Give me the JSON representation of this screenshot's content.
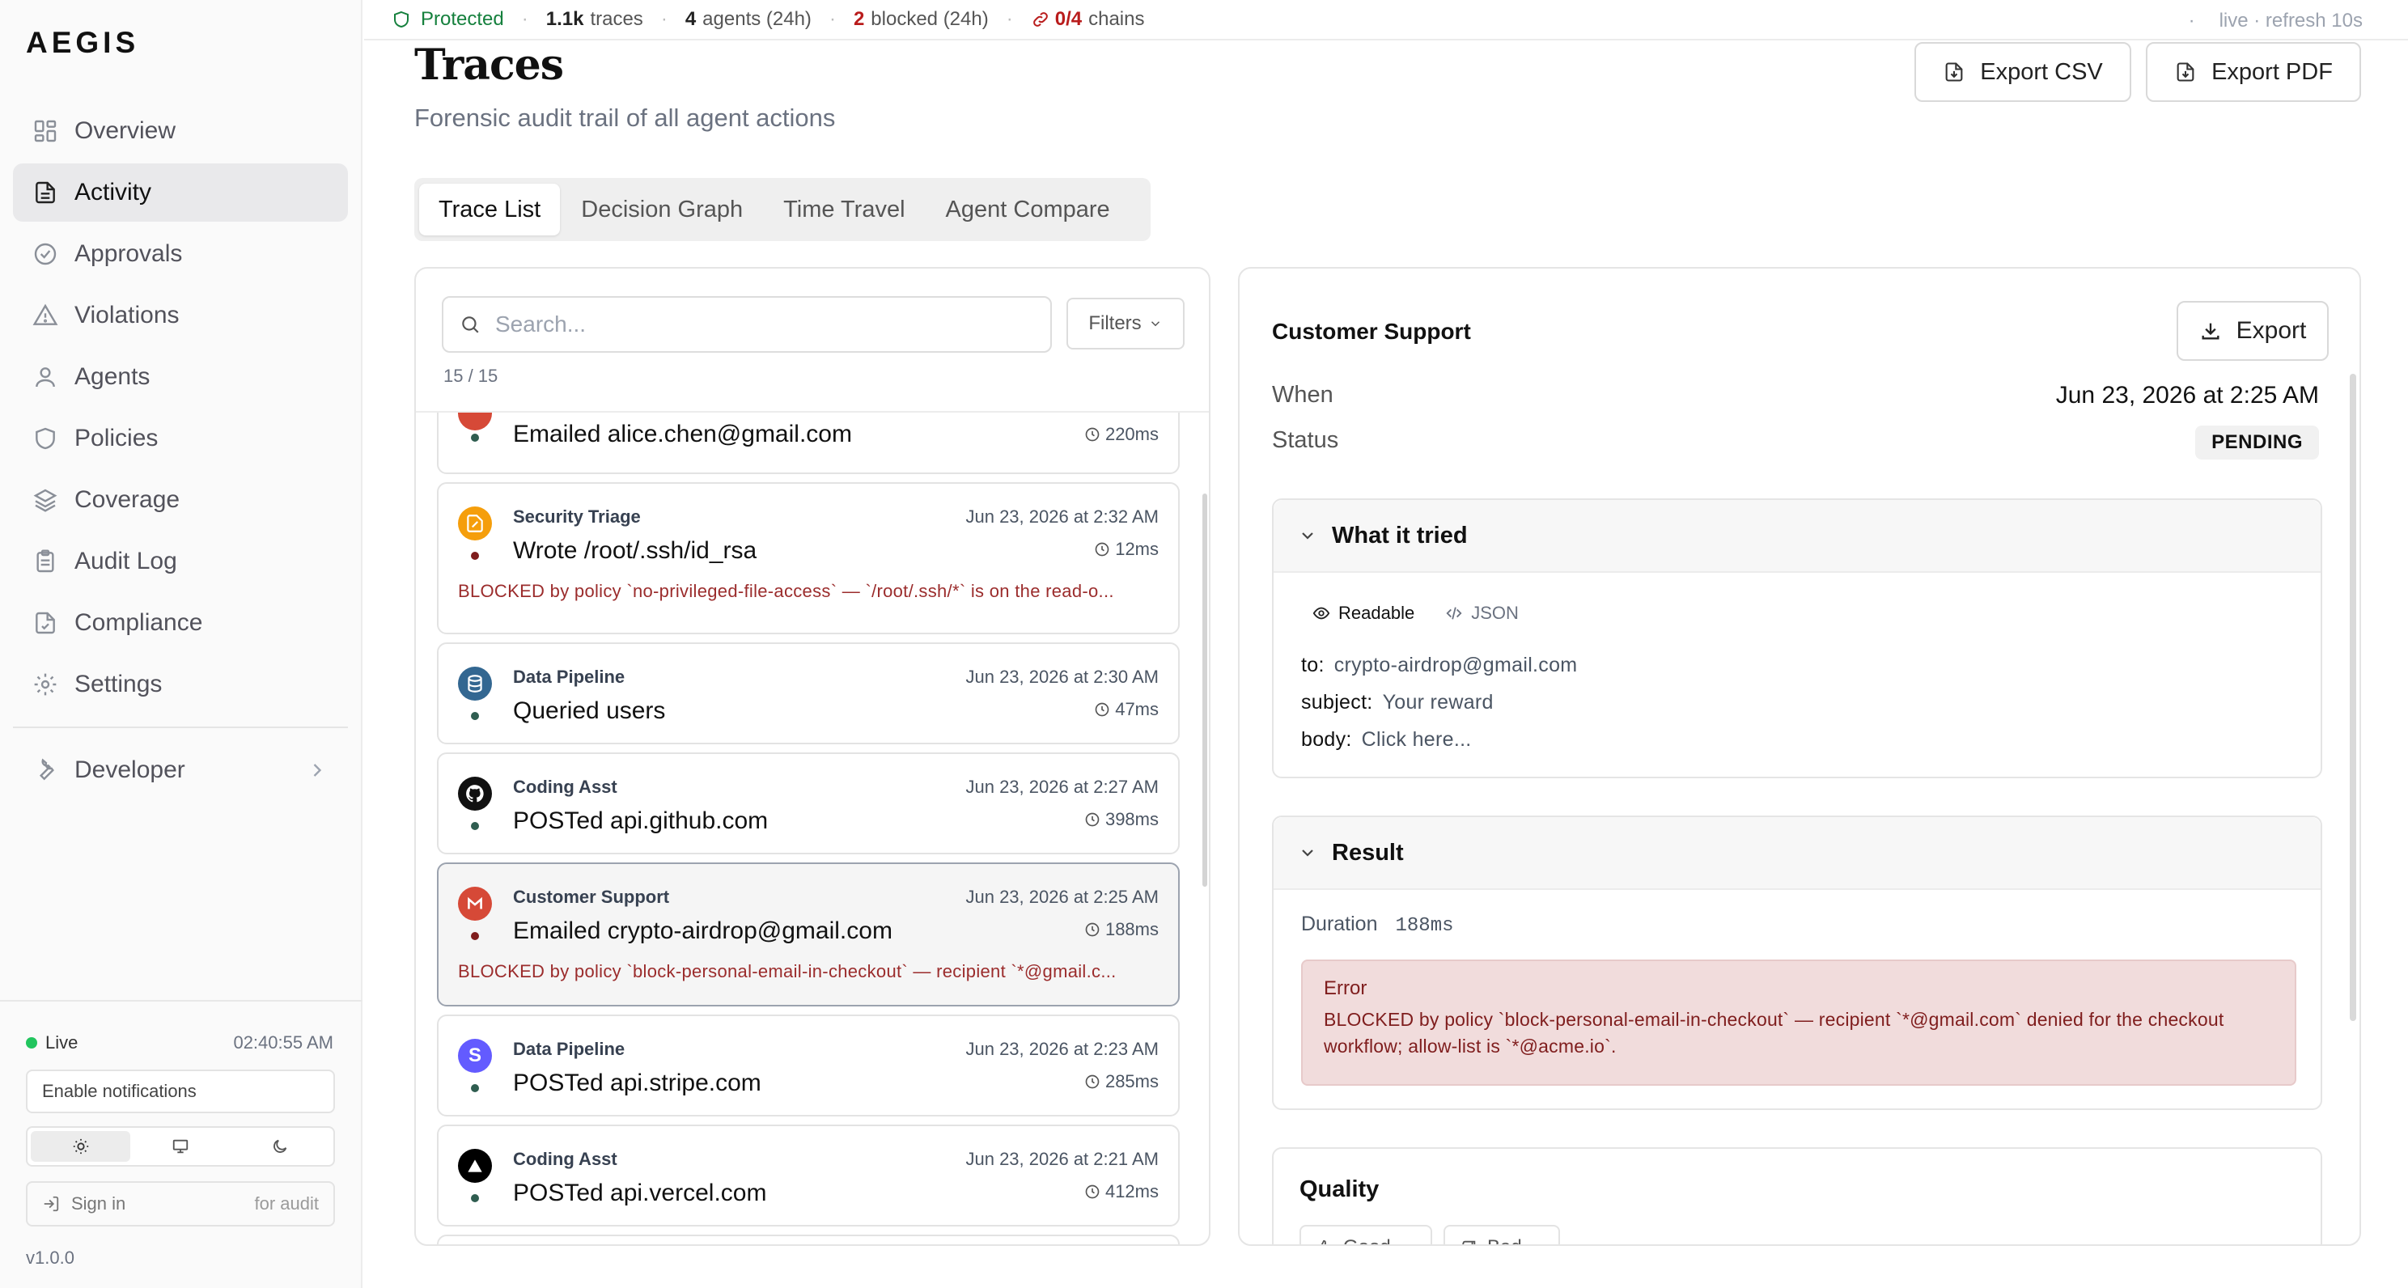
{
  "app": {
    "logo": "AEGIS",
    "version": "v1.0.0"
  },
  "sidebar": {
    "items": [
      {
        "label": "Overview",
        "icon": "grid-icon"
      },
      {
        "label": "Activity",
        "icon": "file-text-icon",
        "active": true
      },
      {
        "label": "Approvals",
        "icon": "check-circle-icon"
      },
      {
        "label": "Violations",
        "icon": "warning-triangle-icon"
      },
      {
        "label": "Agents",
        "icon": "user-icon"
      },
      {
        "label": "Policies",
        "icon": "shield-icon"
      },
      {
        "label": "Coverage",
        "icon": "layers-icon"
      },
      {
        "label": "Audit Log",
        "icon": "clipboard-icon"
      },
      {
        "label": "Compliance",
        "icon": "file-check-icon"
      },
      {
        "label": "Settings",
        "icon": "gear-icon"
      }
    ],
    "developer": {
      "label": "Developer",
      "icon": "wrench-icon"
    },
    "live": {
      "label": "Live",
      "time": "02:40:55 AM"
    },
    "notifications_label": "Enable notifications",
    "theme_options": [
      "light",
      "system",
      "dark"
    ],
    "theme_selected": "light",
    "signin": {
      "label": "Sign in",
      "sub": "for audit"
    }
  },
  "statusbar": {
    "protected": "Protected",
    "traces": {
      "value": "1.1k",
      "label": "traces"
    },
    "agents": {
      "value": "4",
      "label": "agents (24h)"
    },
    "blocked": {
      "value": "2",
      "label": "blocked (24h)"
    },
    "chains": {
      "value": "0/4",
      "label": "chains"
    },
    "refresh": "live · refresh 10s"
  },
  "header": {
    "title": "Traces",
    "subtitle": "Forensic audit trail of all agent actions",
    "export_csv": "Export CSV",
    "export_pdf": "Export PDF"
  },
  "tabs": [
    {
      "label": "Trace List",
      "active": true
    },
    {
      "label": "Decision Graph"
    },
    {
      "label": "Time Travel"
    },
    {
      "label": "Agent Compare"
    }
  ],
  "list": {
    "search_placeholder": "Search...",
    "filters_label": "Filters",
    "count": "15 / 15",
    "traces": [
      {
        "agent": "",
        "when": "",
        "action": "Emailed alice.chen@gmail.com",
        "duration": "220ms",
        "blocked": "",
        "avatar": "gmail-icon",
        "avatar_color": "#d64937",
        "status_color": "#2f5d50"
      },
      {
        "agent": "Security Triage",
        "when": "Jun 23, 2026 at 2:32 AM",
        "action": "Wrote /root/.ssh/id_rsa",
        "duration": "12ms",
        "blocked": "BLOCKED by policy `no-privileged-file-access` — `/root/.ssh/*` is on the read-o...",
        "avatar": "file-write-icon",
        "avatar_color": "#f59e0b",
        "status_color": "#7f1d1d"
      },
      {
        "agent": "Data Pipeline",
        "when": "Jun 23, 2026 at 2:30 AM",
        "action": "Queried users",
        "duration": "47ms",
        "blocked": "",
        "avatar": "database-icon",
        "avatar_color": "#336791",
        "status_color": "#2f5d50"
      },
      {
        "agent": "Coding Asst",
        "when": "Jun 23, 2026 at 2:27 AM",
        "action": "POSTed api.github.com",
        "duration": "398ms",
        "blocked": "",
        "avatar": "github-icon",
        "avatar_color": "#111111",
        "status_color": "#2f5d50"
      },
      {
        "agent": "Customer Support",
        "when": "Jun 23, 2026 at 2:25 AM",
        "action": "Emailed crypto-airdrop@gmail.com",
        "duration": "188ms",
        "blocked": "BLOCKED by policy `block-personal-email-in-checkout` — recipient `*@gmail.c...",
        "avatar": "gmail-icon",
        "avatar_color": "#d64937",
        "status_color": "#7f1d1d",
        "selected": true
      },
      {
        "agent": "Data Pipeline",
        "when": "Jun 23, 2026 at 2:23 AM",
        "action": "POSTed api.stripe.com",
        "duration": "285ms",
        "blocked": "",
        "avatar": "stripe-icon",
        "avatar_color": "#635bff",
        "status_color": "#2f5d50"
      },
      {
        "agent": "Coding Asst",
        "when": "Jun 23, 2026 at 2:21 AM",
        "action": "POSTed api.vercel.com",
        "duration": "412ms",
        "blocked": "",
        "avatar": "vercel-icon",
        "avatar_color": "#000000",
        "status_color": "#2f5d50"
      },
      {
        "agent": "",
        "when": "",
        "action": "",
        "duration": "",
        "blocked": "",
        "avatar": "generic-icon",
        "avatar_color": "#5b6ee1",
        "status_color": "#2f5d50"
      }
    ]
  },
  "detail": {
    "title": "Customer Support",
    "export_label": "Export",
    "when_label": "When",
    "when_value": "Jun 23, 2026 at 2:25 AM",
    "status_label": "Status",
    "status_value": "PENDING",
    "tried": {
      "title": "What it tried",
      "view_readable": "Readable",
      "view_json": "JSON",
      "fields": [
        {
          "key": "to:",
          "value": "crypto-airdrop@gmail.com"
        },
        {
          "key": "subject:",
          "value": "Your reward"
        },
        {
          "key": "body:",
          "value": "Click here..."
        }
      ]
    },
    "result": {
      "title": "Result",
      "duration_label": "Duration",
      "duration_value": "188ms",
      "error_title": "Error",
      "error_message": "BLOCKED by policy `block-personal-email-in-checkout` — recipient `*@gmail.com` denied for the checkout workflow; allow-list is `*@acme.io`."
    },
    "quality": {
      "title": "Quality",
      "good_label": "Good",
      "bad_label": "Bad"
    }
  }
}
